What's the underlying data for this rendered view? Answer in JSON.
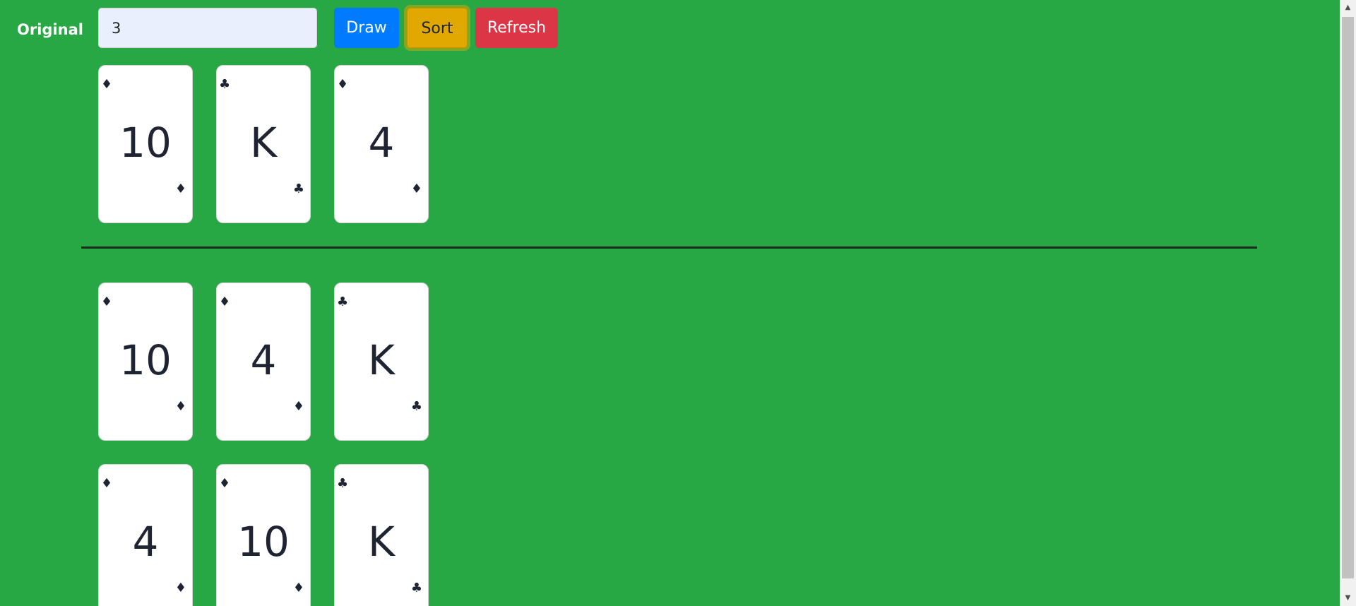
{
  "toolbar": {
    "label": "Original",
    "count_value": "3",
    "draw_label": "Draw",
    "sort_label": "Sort",
    "refresh_label": "Refresh"
  },
  "original_hand": [
    {
      "rank": "10",
      "suit": "♦",
      "suit_name": "diamonds-icon"
    },
    {
      "rank": "K",
      "suit": "♣",
      "suit_name": "clubs-icon"
    },
    {
      "rank": "4",
      "suit": "♦",
      "suit_name": "diamonds-icon"
    }
  ],
  "sorted_rows": [
    [
      {
        "rank": "10",
        "suit": "♦",
        "suit_name": "diamonds-icon"
      },
      {
        "rank": "4",
        "suit": "♦",
        "suit_name": "diamonds-icon"
      },
      {
        "rank": "K",
        "suit": "♣",
        "suit_name": "clubs-icon"
      }
    ],
    [
      {
        "rank": "4",
        "suit": "♦",
        "suit_name": "diamonds-icon"
      },
      {
        "rank": "10",
        "suit": "♦",
        "suit_name": "diamonds-icon"
      },
      {
        "rank": "K",
        "suit": "♣",
        "suit_name": "clubs-icon"
      }
    ]
  ],
  "colors": {
    "background": "#28a745",
    "draw_button": "#007bff",
    "sort_button": "#e0a800",
    "refresh_button": "#dc3545",
    "card_ink": "#1f2433"
  },
  "scrollbar": {
    "up_arrow": "▲",
    "down_arrow": "▼"
  }
}
